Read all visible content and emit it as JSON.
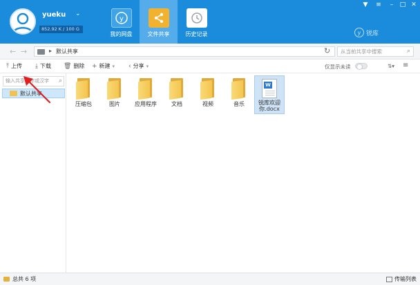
{
  "header": {
    "username": "yueku",
    "quota": "852.92 K / 100 G",
    "tabs": [
      {
        "label": "我的网盘",
        "icon": "cloud-disk-icon"
      },
      {
        "label": "文件共享",
        "icon": "share-icon"
      },
      {
        "label": "历史记录",
        "icon": "clock-icon"
      }
    ],
    "logo": "锐库",
    "logo_mark": "y"
  },
  "address": {
    "breadcrumb": "默认共享",
    "search_placeholder": "从当前共享中搜索"
  },
  "toolbar": {
    "upload": "上传",
    "download": "下载",
    "delete": "删除",
    "new": "新建",
    "share": "分享",
    "show_only": "仅显示未读"
  },
  "sidebar": {
    "search_placeholder": "输入共享名称或汉字",
    "items": [
      {
        "label": "默认共享"
      }
    ]
  },
  "files": [
    {
      "name": "压缩包",
      "type": "folder"
    },
    {
      "name": "图片",
      "type": "folder"
    },
    {
      "name": "应用程序",
      "type": "folder"
    },
    {
      "name": "文档",
      "type": "folder"
    },
    {
      "name": "视频",
      "type": "folder"
    },
    {
      "name": "音乐",
      "type": "folder"
    },
    {
      "name_line1": "锐库欢迎",
      "name_line2": "你.docx",
      "type": "docx"
    }
  ],
  "status": {
    "total": "总共 6 项",
    "transfer": "传输列表"
  },
  "colors": {
    "header_bg": "#1a8cdb",
    "active_tab": "#55acea",
    "selection": "#cfe7fb",
    "arrow": "#e02020"
  }
}
